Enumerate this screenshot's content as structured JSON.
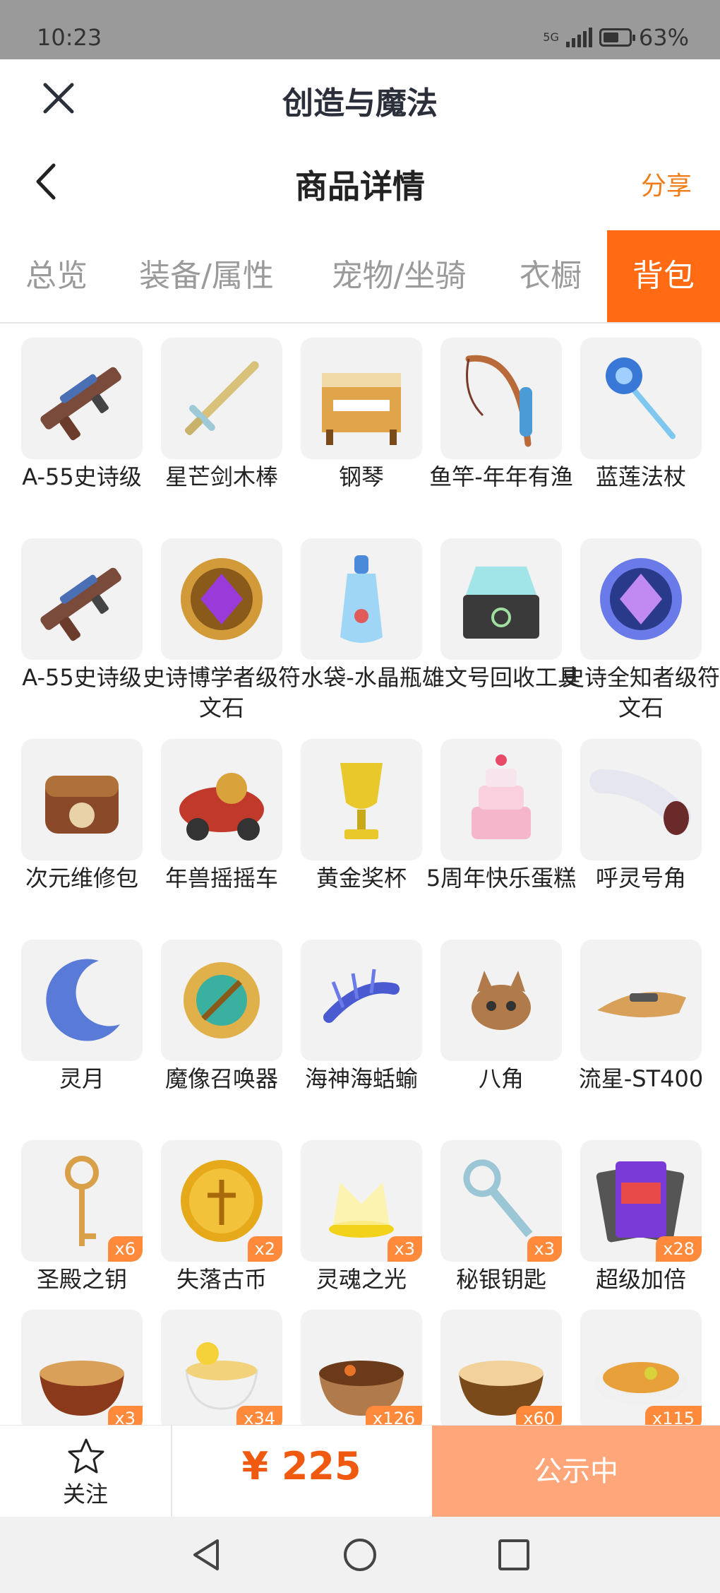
{
  "status": {
    "time": "10:23",
    "network": "5G",
    "battery": "63%",
    "battery_level": 0.63
  },
  "app": {
    "title": "创造与魔法"
  },
  "nav": {
    "title": "商品详情",
    "share": "分享"
  },
  "tabs": [
    {
      "label": "总览",
      "active": false
    },
    {
      "label": "装备/属性",
      "active": false
    },
    {
      "label": "宠物/坐骑",
      "active": false
    },
    {
      "label": "衣橱",
      "active": false
    },
    {
      "label": "背包",
      "active": true
    }
  ],
  "items": [
    {
      "name": "A-55史诗级",
      "icon": "rifle-icon",
      "qty": ""
    },
    {
      "name": "星芒剑木棒",
      "icon": "sword-icon",
      "qty": ""
    },
    {
      "name": "钢琴",
      "icon": "piano-icon",
      "qty": ""
    },
    {
      "name": "鱼竿-年年有渔",
      "icon": "fishing-rod-icon",
      "qty": ""
    },
    {
      "name": "蓝莲法杖",
      "icon": "staff-icon",
      "qty": ""
    },
    {
      "name": "A-55史诗级",
      "icon": "rifle-icon",
      "qty": ""
    },
    {
      "name": "史诗博学者级符文石",
      "icon": "rune-stone-purple-icon",
      "qty": ""
    },
    {
      "name": "水袋-水晶瓶",
      "icon": "crystal-bottle-icon",
      "qty": ""
    },
    {
      "name": "雄文号回收工具",
      "icon": "recycle-box-icon",
      "qty": ""
    },
    {
      "name": "史诗全知者级符文石",
      "icon": "rune-stone-blue-icon",
      "qty": ""
    },
    {
      "name": "次元维修包",
      "icon": "repair-bag-icon",
      "qty": ""
    },
    {
      "name": "年兽摇摇车",
      "icon": "rocking-car-icon",
      "qty": ""
    },
    {
      "name": "黄金奖杯",
      "icon": "trophy-icon",
      "qty": ""
    },
    {
      "name": "5周年快乐蛋糕",
      "icon": "cake-icon",
      "qty": ""
    },
    {
      "name": "呼灵号角",
      "icon": "horn-icon",
      "qty": ""
    },
    {
      "name": "灵月",
      "icon": "moon-icon",
      "qty": ""
    },
    {
      "name": "魔像召唤器",
      "icon": "golem-summoner-icon",
      "qty": ""
    },
    {
      "name": "海神海蛞蝓",
      "icon": "sea-slug-icon",
      "qty": ""
    },
    {
      "name": "八角",
      "icon": "creature-icon",
      "qty": ""
    },
    {
      "name": "流星-ST400",
      "icon": "hover-bike-icon",
      "qty": ""
    },
    {
      "name": "圣殿之钥",
      "icon": "golden-key-icon",
      "qty": "x6"
    },
    {
      "name": "失落古币",
      "icon": "gold-coin-icon",
      "qty": "x2"
    },
    {
      "name": "灵魂之光",
      "icon": "soul-light-icon",
      "qty": "x3"
    },
    {
      "name": "秘银钥匙",
      "icon": "silver-key-icon",
      "qty": "x3"
    },
    {
      "name": "超级加倍",
      "icon": "card-pack-icon",
      "qty": "x28"
    },
    {
      "name": "",
      "icon": "soup-bowl-icon",
      "qty": "x3"
    },
    {
      "name": "",
      "icon": "tea-cup-icon",
      "qty": "x34"
    },
    {
      "name": "",
      "icon": "stew-bowl-icon",
      "qty": "x126"
    },
    {
      "name": "",
      "icon": "porridge-bowl-icon",
      "qty": "x60"
    },
    {
      "name": "",
      "icon": "gratin-dish-icon",
      "qty": "x115"
    }
  ],
  "bottom": {
    "follow": "关注",
    "price": "¥ 225",
    "status": "公示中"
  },
  "colors": {
    "accent": "#ff6a13",
    "price": "#f05a10",
    "status_button": "#ffa77a",
    "share": "#f07d1a"
  }
}
